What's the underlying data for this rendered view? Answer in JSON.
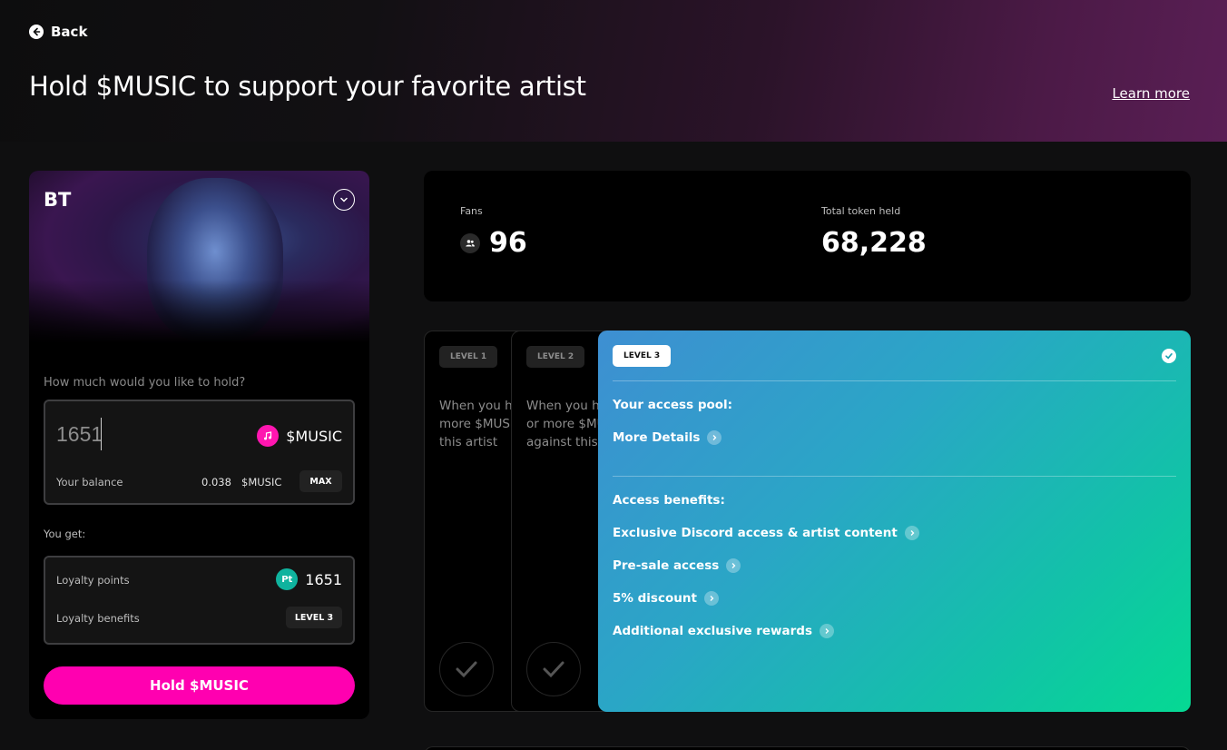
{
  "header": {
    "back_label": "Back",
    "title": "Hold $MUSIC to support your favorite artist",
    "learn_more": "Learn more"
  },
  "artist": {
    "name": "BT",
    "hold_question": "How much would you like to hold?",
    "amount": "1651",
    "token": "$MUSIC",
    "balance_label": "Your balance",
    "balance_value": "0.038",
    "balance_unit": "$MUSIC",
    "max_label": "MAX",
    "you_get": "You get:",
    "loyalty_points_label": "Loyalty points",
    "loyalty_points_icon": "Pt",
    "loyalty_points_value": "1651",
    "loyalty_benefits_label": "Loyalty benefits",
    "loyalty_benefits_value": "LEVEL 3",
    "hold_button": "Hold $MUSIC"
  },
  "stats": {
    "fans_label": "Fans",
    "fans_value": "96",
    "tokens_label": "Total token held",
    "tokens_value": "68,228"
  },
  "levels": [
    {
      "label": "LEVEL 1",
      "description": "When you ho\nmore $MUSIC\nthis artist"
    },
    {
      "label": "LEVEL 2",
      "description": "When you ho\nor more $MU\nagainst this a"
    },
    {
      "label": "LEVEL 3",
      "access_pool_title": "Your access pool:",
      "more_details": "More Details",
      "benefits_title": "Access benefits:",
      "benefits": [
        "Exclusive Discord access & artist content",
        "Pre-sale access",
        "5% discount",
        "Additional exclusive rewards"
      ]
    }
  ],
  "colors": {
    "accent": "#ff00b0",
    "level3_start": "#3e8fd2",
    "level3_end": "#05d993",
    "points": "#0fb39e"
  },
  "icons": [
    "arrow-left-icon",
    "chevron-down-icon",
    "music-note-icon",
    "points-icon",
    "fans-icon",
    "check-icon",
    "info-chevron-icon"
  ]
}
